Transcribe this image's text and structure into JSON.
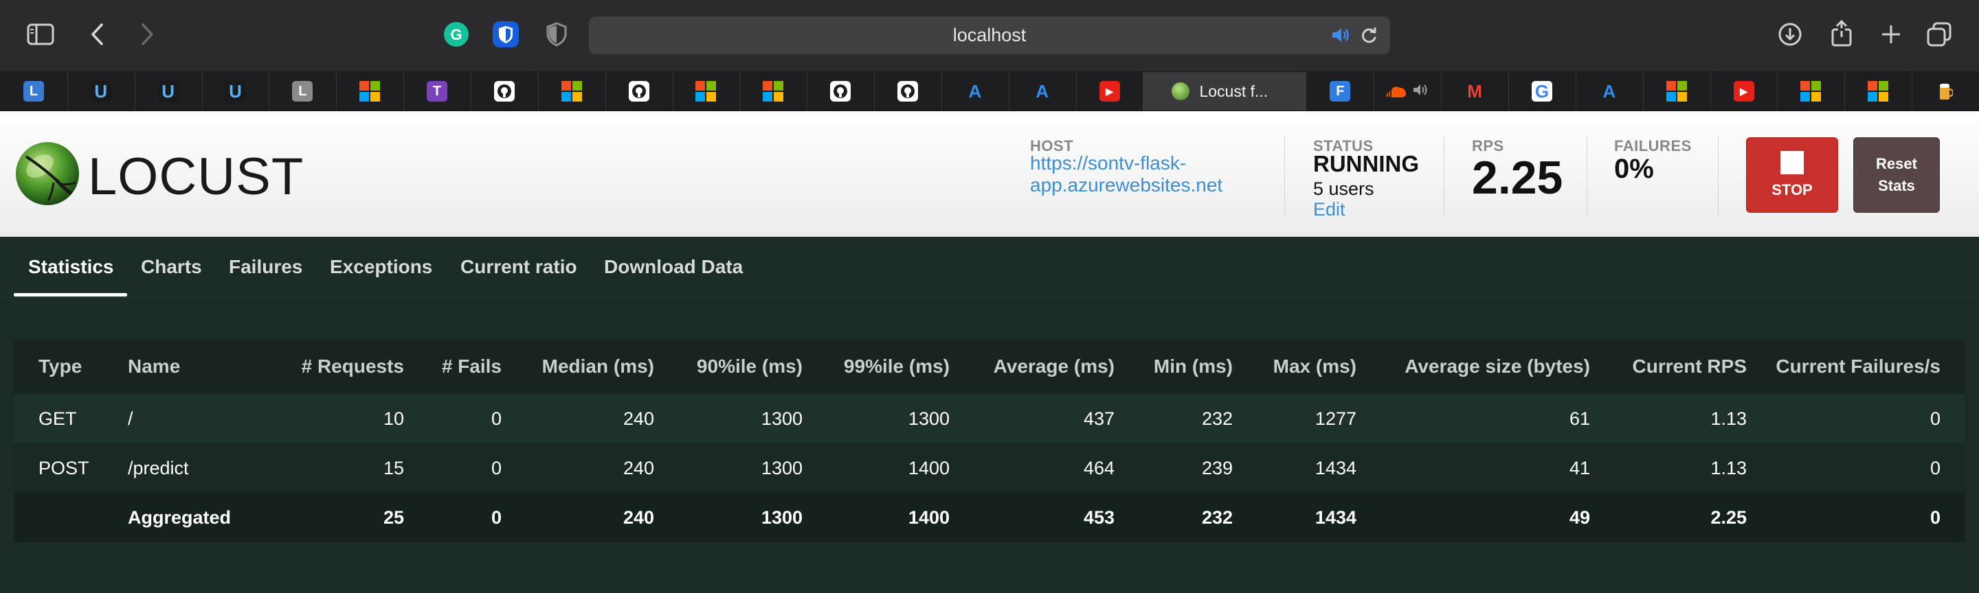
{
  "browser": {
    "url": "localhost",
    "icons": [
      "sidebar-icon",
      "back-icon",
      "forward-icon",
      "grammarly-icon",
      "bitwarden-icon",
      "privacy-shield-icon",
      "download-icon",
      "share-icon",
      "new-tab-icon",
      "tab-overview-icon"
    ],
    "tabs": [
      {
        "icon": "L",
        "icon_bg": "#3a7bd5"
      },
      {
        "icon": "U",
        "icon_bg": "#1a1a1a",
        "icon_color": "#4fb3ff"
      },
      {
        "icon": "U",
        "icon_bg": "#1a1a1a",
        "icon_color": "#4fb3ff"
      },
      {
        "icon": "U",
        "icon_bg": "#1a1a1a",
        "icon_color": "#4fb3ff"
      },
      {
        "icon": "L",
        "icon_bg": "#8a8a8f"
      },
      {
        "icon": "microsoft"
      },
      {
        "icon": "T",
        "icon_bg": "#7b42bc"
      },
      {
        "icon": "github"
      },
      {
        "icon": "microsoft"
      },
      {
        "icon": "github"
      },
      {
        "icon": "microsoft"
      },
      {
        "icon": "microsoft"
      },
      {
        "icon": "github"
      },
      {
        "icon": "github"
      },
      {
        "icon": "A",
        "icon_bg": "#1e1e20",
        "icon_color": "#2f8ef0"
      },
      {
        "icon": "A",
        "icon_bg": "#1e1e20",
        "icon_color": "#2f8ef0"
      },
      {
        "icon": "▶",
        "icon_bg": "#e62117"
      },
      {
        "icon": "locust",
        "title": "Locust f...",
        "active": true
      },
      {
        "icon": "F",
        "icon_bg": "#2f7de1"
      },
      {
        "icon": "soundcloud"
      },
      {
        "icon": "M",
        "icon_bg": "#1e1e20",
        "icon_color": "#ea4335"
      },
      {
        "icon": "G",
        "icon_bg": "#ffffff",
        "icon_color": "#4285f4"
      },
      {
        "icon": "A",
        "icon_bg": "#1e1e20",
        "icon_color": "#2f8ef0"
      },
      {
        "icon": "microsoft"
      },
      {
        "icon": "▶",
        "icon_bg": "#e62117"
      },
      {
        "icon": "microsoft"
      },
      {
        "icon": "microsoft"
      },
      {
        "icon": "beer"
      }
    ]
  },
  "header": {
    "logo_text": "LOCUST",
    "host": {
      "label": "HOST",
      "value": "https://sontv-flask-app.azurewebsites.net"
    },
    "status": {
      "label": "STATUS",
      "value": "RUNNING",
      "users": "5 users",
      "edit": "Edit"
    },
    "rps": {
      "label": "RPS",
      "value": "2.25"
    },
    "failures": {
      "label": "FAILURES",
      "value": "0%"
    },
    "stop_label": "STOP",
    "reset_label": "Reset Stats"
  },
  "nav": {
    "tabs": [
      "Statistics",
      "Charts",
      "Failures",
      "Exceptions",
      "Current ratio",
      "Download Data"
    ],
    "active": "Statistics"
  },
  "stats": {
    "columns": [
      "Type",
      "Name",
      "# Requests",
      "# Fails",
      "Median (ms)",
      "90%ile (ms)",
      "99%ile (ms)",
      "Average (ms)",
      "Min (ms)",
      "Max (ms)",
      "Average size (bytes)",
      "Current RPS",
      "Current Failures/s"
    ],
    "rows": [
      [
        "GET",
        "/",
        "10",
        "0",
        "240",
        "1300",
        "1300",
        "437",
        "232",
        "1277",
        "61",
        "1.13",
        "0"
      ],
      [
        "POST",
        "/predict",
        "15",
        "0",
        "240",
        "1300",
        "1400",
        "464",
        "239",
        "1434",
        "41",
        "1.13",
        "0"
      ]
    ],
    "aggregated": [
      "",
      "Aggregated",
      "25",
      "0",
      "240",
      "1300",
      "1400",
      "453",
      "232",
      "1434",
      "49",
      "2.25",
      "0"
    ]
  },
  "colors": {
    "page_bg": "#1b2b26",
    "link": "#3d8ed0",
    "stop_button": "#c8312b",
    "reset_button": "#574645"
  }
}
